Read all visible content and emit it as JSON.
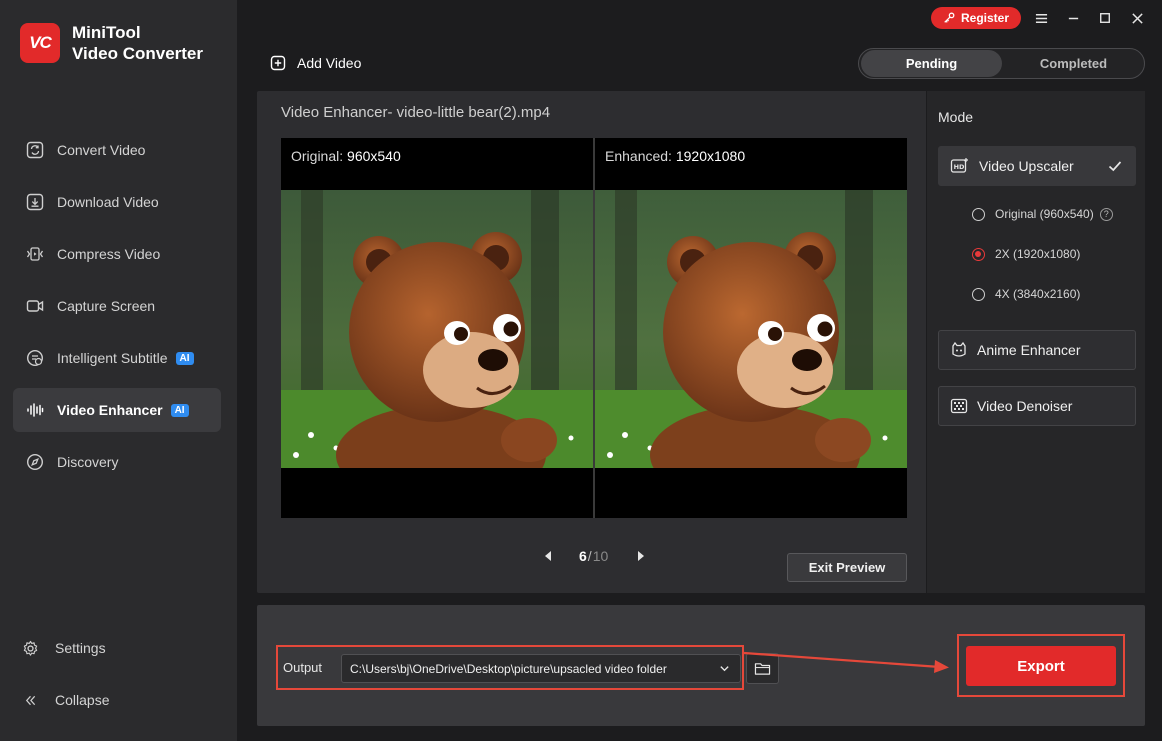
{
  "app": {
    "name_line1": "MiniTool",
    "name_line2": "Video Converter",
    "logo_text": "VC",
    "accent_color": "#e22a2a"
  },
  "titlebar": {
    "register_label": "Register"
  },
  "sidebar": {
    "items": [
      {
        "label": "Convert Video",
        "icon": "convert-icon"
      },
      {
        "label": "Download Video",
        "icon": "download-icon"
      },
      {
        "label": "Compress Video",
        "icon": "compress-icon"
      },
      {
        "label": "Capture Screen",
        "icon": "camera-icon"
      },
      {
        "label": "Intelligent Subtitle",
        "icon": "subtitle-icon",
        "badge": "AI"
      },
      {
        "label": "Video Enhancer",
        "icon": "waveform-icon",
        "badge": "AI",
        "active": true
      },
      {
        "label": "Discovery",
        "icon": "compass-icon"
      }
    ],
    "settings_label": "Settings",
    "collapse_label": "Collapse"
  },
  "topbar": {
    "add_video_label": "Add Video",
    "tabs": [
      {
        "label": "Pending",
        "active": true
      },
      {
        "label": "Completed",
        "active": false
      }
    ]
  },
  "preview": {
    "title": "Video Enhancer- video-little bear(2).mp4",
    "original_label": "Original:",
    "original_value": "960x540",
    "enhanced_label": "Enhanced:",
    "enhanced_value": "1920x1080",
    "page_current": "6",
    "page_separator": "/",
    "page_total": "10",
    "exit_label": "Exit Preview"
  },
  "mode": {
    "title": "Mode",
    "upscaler_label": "Video Upscaler",
    "options": [
      {
        "label": "Original (960x540)",
        "selected": false
      },
      {
        "label": "2X (1920x1080)",
        "selected": true
      },
      {
        "label": "4X (3840x2160)",
        "selected": false
      }
    ],
    "anime_label": "Anime Enhancer",
    "denoiser_label": "Video Denoiser"
  },
  "output": {
    "label": "Output",
    "path": "C:\\Users\\bj\\OneDrive\\Desktop\\picture\\upsacled video folder",
    "export_label": "Export"
  }
}
